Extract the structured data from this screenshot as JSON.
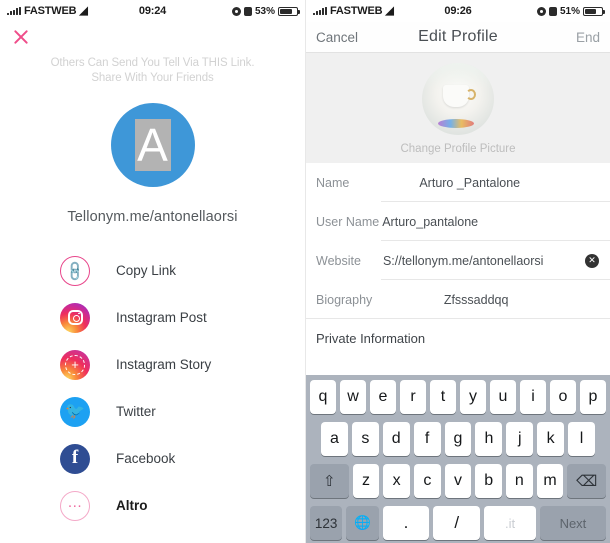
{
  "left_screen": {
    "status_bar": {
      "carrier": "FASTWEB",
      "wifi_icon": "wifi-icon",
      "time": "09:24",
      "battery_percent": "53%",
      "location_icon": "location-icon",
      "lock_icon": "lock-icon",
      "battery_icon": "battery-icon"
    },
    "close_icon": "close-icon",
    "caption_line1": "Others Can Send You Tell Via THIS Link.",
    "caption_line2": "Share With Your Friends",
    "avatar_letter": "A",
    "avatar_color": "#3e97d8",
    "profile_url": "Tellonym.me/antonellaorsi",
    "share_items": [
      {
        "label": "Copy Link",
        "icon": "copy-link-icon"
      },
      {
        "label": "Instagram Post",
        "icon": "instagram-post-icon"
      },
      {
        "label": "Instagram Story",
        "icon": "instagram-story-icon"
      },
      {
        "label": "Twitter",
        "icon": "twitter-icon"
      },
      {
        "label": "Facebook",
        "icon": "facebook-icon"
      },
      {
        "label": "Altro",
        "icon": "more-icon"
      }
    ]
  },
  "right_screen": {
    "status_bar": {
      "carrier": "FASTWEB",
      "wifi_icon": "wifi-icon",
      "time": "09:26",
      "battery_percent": "51%",
      "location_icon": "location-icon",
      "lock_icon": "lock-icon",
      "battery_icon": "battery-icon"
    },
    "nav": {
      "cancel_label": "Cancel",
      "title": "Edit Profile",
      "done_label": "End"
    },
    "profile_picture": {
      "caption": "Change Profile Picture",
      "image": "coffee-cup-photo"
    },
    "fields": [
      {
        "label": "Name",
        "value": "Arturo _Pantalone"
      },
      {
        "label": "User Name",
        "value": "Arturo_pantalone"
      },
      {
        "label": "Website",
        "value": "S://tellonym.me/antonellaorsi",
        "clear_icon": "clear-icon"
      },
      {
        "label": "Biography",
        "value": "Zfsssaddqq"
      }
    ],
    "section_title": "Private Information",
    "keyboard": {
      "row1": [
        "q",
        "w",
        "e",
        "r",
        "t",
        "y",
        "u",
        "i",
        "o",
        "p"
      ],
      "row2": [
        "a",
        "s",
        "d",
        "f",
        "g",
        "h",
        "j",
        "k",
        "l"
      ],
      "row3": [
        "z",
        "x",
        "c",
        "v",
        "b",
        "n",
        "m"
      ],
      "shift_key": "⇧",
      "backspace_key": "⌫",
      "numbers_key": "123",
      "globe_key": "🌐",
      "period_key": ".",
      "slash_key": "/",
      "space_key": ".it",
      "next_key": "Next"
    }
  }
}
